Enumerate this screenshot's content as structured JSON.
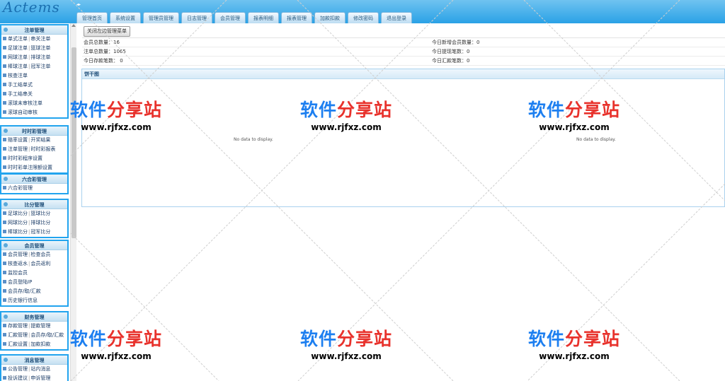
{
  "app": {
    "logo": "Actems",
    "collapse": "◂▸"
  },
  "tabs": [
    "管理首页",
    "系统设置",
    "管理员管理",
    "日志管理",
    "会员管理",
    "报表明细",
    "报表管理",
    "加款扣款",
    "修改密码",
    "退出登录"
  ],
  "sidebar": {
    "panels": [
      {
        "title": "注单管理",
        "items": [
          [
            "单式注单",
            "串关注单"
          ],
          [
            "足球注单",
            "篮球注单"
          ],
          [
            "网球注单",
            "排球注单"
          ],
          [
            "棒球注单",
            "冠军注单"
          ],
          [
            "核查注单"
          ],
          [
            "手工结单式"
          ],
          [
            "手工结串关"
          ],
          [
            "滚球未审核注单"
          ],
          [
            "滚球自动审核"
          ]
        ]
      },
      {
        "title": "时时彩管理",
        "items": [
          [
            "赔率设置",
            "开奖结果"
          ],
          [
            "注单管理",
            "时时彩报表"
          ],
          [
            "时时彩程序设置"
          ],
          [
            "时时彩单注限额设置"
          ]
        ]
      },
      {
        "title": "六合彩管理",
        "items": [
          [
            "六合彩管理"
          ]
        ]
      },
      {
        "title": "比分管理",
        "items": [
          [
            "足球比分",
            "篮球比分"
          ],
          [
            "网球比分",
            "排球比分"
          ],
          [
            "棒球比分",
            "冠军比分"
          ]
        ]
      },
      {
        "title": "会员管理",
        "items": [
          [
            "会员管理",
            "检查会员"
          ],
          [
            "核查返水",
            "会员返利"
          ],
          [
            "监控会员"
          ],
          [
            "会员登陆IP"
          ],
          [
            "会员存/取/汇款"
          ],
          [
            "历史银行信息"
          ]
        ]
      },
      {
        "title": "财务管理",
        "items": [
          [
            "存款管理",
            "提款管理"
          ],
          [
            "汇款管理",
            "会员存/取/汇款"
          ],
          [
            "汇款设置",
            "加款扣款"
          ]
        ]
      },
      {
        "title": "消息管理",
        "items": [
          [
            "公告管理",
            "站内消息"
          ],
          [
            "投诉建议",
            "申诉管理"
          ]
        ]
      }
    ]
  },
  "main": {
    "close_menu_button": "关闭左边管理菜单",
    "stats": [
      {
        "left": "会员总数量：16",
        "right": "今日新增会员数量：0"
      },
      {
        "left": "注单总数量：1065",
        "right": "今日提现笔数：0"
      },
      {
        "left": "今日存款笔数： 0",
        "right": "今日汇款笔数：0"
      }
    ],
    "pie_title": "饼干图",
    "no_data": [
      "No data to display.",
      "No data to display."
    ]
  },
  "watermark": {
    "cn_a": "软件",
    "cn_b": "分享站",
    "en": "www.rjfxz.com"
  }
}
